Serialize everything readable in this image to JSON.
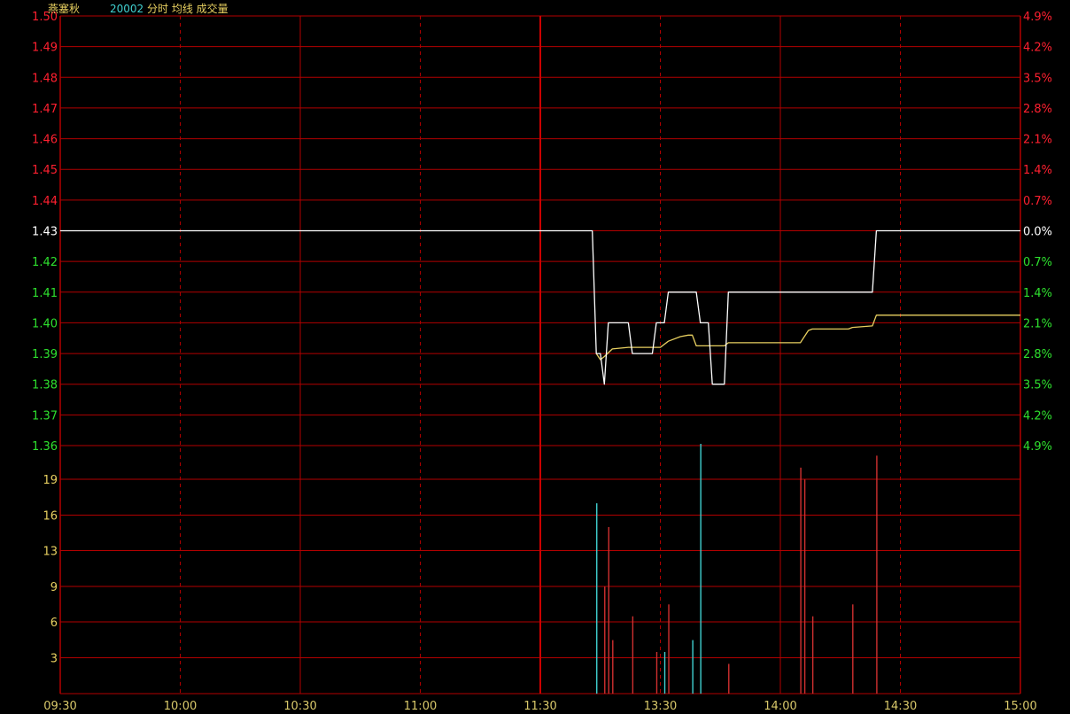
{
  "header": {
    "name": "燕塞秋",
    "code": "20002",
    "labels": "分时 均线 成交量"
  },
  "colors": {
    "background": "#000000",
    "grid": "#b30000",
    "up": "#ff2030",
    "down": "#2ee02e",
    "flat": "#ffffff",
    "price_line": "#ffffff",
    "avg_line": "#e8d060",
    "vol_up": "#d03030",
    "vol_down": "#40d0d0",
    "volume_labels": "#e8d060",
    "time_labels": "#d8c86a",
    "header_name": "#e8d060",
    "header_code": "#40d0d0",
    "header_labels": "#e8d060"
  },
  "chart_data": {
    "type": "line",
    "prev_close": 1.43,
    "price_axis": {
      "ticks": [
        "1.50",
        "1.49",
        "1.48",
        "1.47",
        "1.46",
        "1.45",
        "1.44",
        "1.43",
        "1.42",
        "1.41",
        "1.40",
        "1.39",
        "1.38",
        "1.37",
        "1.36"
      ],
      "range": [
        1.36,
        1.5
      ]
    },
    "percent_axis": {
      "ticks": [
        "4.9%",
        "4.2%",
        "3.5%",
        "2.8%",
        "2.1%",
        "1.4%",
        "0.7%",
        "0.0%",
        "0.7%",
        "1.4%",
        "2.1%",
        "2.8%",
        "3.5%",
        "4.2%",
        "4.9%"
      ]
    },
    "volume_axis": {
      "ticks": [
        "19",
        "16",
        "13",
        "9",
        "6",
        "3"
      ],
      "range": [
        0,
        21
      ]
    },
    "time_axis": {
      "ticks": [
        "09:30",
        "10:00",
        "10:30",
        "11:00",
        "11:30",
        "13:30",
        "14:00",
        "14:30",
        "15:00"
      ]
    },
    "series": [
      {
        "role": "price",
        "points": [
          [
            "09:30",
            1.43
          ],
          [
            "11:30",
            1.43
          ],
          [
            "13:13",
            1.43
          ],
          [
            "13:14",
            1.39
          ],
          [
            "13:15",
            1.39
          ],
          [
            "13:16",
            1.38
          ],
          [
            "13:17",
            1.4
          ],
          [
            "13:22",
            1.4
          ],
          [
            "13:23",
            1.39
          ],
          [
            "13:28",
            1.39
          ],
          [
            "13:29",
            1.4
          ],
          [
            "13:31",
            1.4
          ],
          [
            "13:32",
            1.41
          ],
          [
            "13:39",
            1.41
          ],
          [
            "13:40",
            1.4
          ],
          [
            "13:42",
            1.4
          ],
          [
            "13:43",
            1.38
          ],
          [
            "13:46",
            1.38
          ],
          [
            "13:47",
            1.41
          ],
          [
            "14:23",
            1.41
          ],
          [
            "14:24",
            1.43
          ],
          [
            "15:00",
            1.43
          ]
        ]
      },
      {
        "role": "average",
        "points": [
          [
            "13:14",
            1.39
          ],
          [
            "13:15",
            1.388
          ],
          [
            "13:16",
            1.389
          ],
          [
            "13:18",
            1.3915
          ],
          [
            "13:22",
            1.392
          ],
          [
            "13:30",
            1.392
          ],
          [
            "13:32",
            1.394
          ],
          [
            "13:35",
            1.3955
          ],
          [
            "13:37",
            1.396
          ],
          [
            "13:38",
            1.396
          ],
          [
            "13:39",
            1.3925
          ],
          [
            "13:46",
            1.3925
          ],
          [
            "13:47",
            1.3935
          ],
          [
            "14:05",
            1.3935
          ],
          [
            "14:07",
            1.3975
          ],
          [
            "14:08",
            1.398
          ],
          [
            "14:17",
            1.398
          ],
          [
            "14:18",
            1.3985
          ],
          [
            "14:23",
            1.399
          ],
          [
            "14:24",
            1.4025
          ],
          [
            "15:00",
            1.4025
          ]
        ]
      }
    ],
    "volume": [
      {
        "t": "13:14",
        "v": 16,
        "dir": "down"
      },
      {
        "t": "13:16",
        "v": 9,
        "dir": "up"
      },
      {
        "t": "13:17",
        "v": 14,
        "dir": "up"
      },
      {
        "t": "13:18",
        "v": 4.5,
        "dir": "up"
      },
      {
        "t": "13:23",
        "v": 6.5,
        "dir": "up"
      },
      {
        "t": "13:29",
        "v": 3.5,
        "dir": "up"
      },
      {
        "t": "13:31",
        "v": 3.5,
        "dir": "down"
      },
      {
        "t": "13:32",
        "v": 7.5,
        "dir": "up"
      },
      {
        "t": "13:38",
        "v": 4.5,
        "dir": "down"
      },
      {
        "t": "13:40",
        "v": 21,
        "dir": "down"
      },
      {
        "t": "13:47",
        "v": 2.5,
        "dir": "up"
      },
      {
        "t": "14:05",
        "v": 19,
        "dir": "up"
      },
      {
        "t": "14:06",
        "v": 18,
        "dir": "up"
      },
      {
        "t": "14:08",
        "v": 6.5,
        "dir": "up"
      },
      {
        "t": "14:18",
        "v": 7.5,
        "dir": "up"
      },
      {
        "t": "14:24",
        "v": 20,
        "dir": "up"
      }
    ]
  }
}
